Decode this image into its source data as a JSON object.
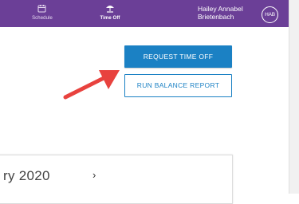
{
  "nav": {
    "items": [
      {
        "label": "Schedule",
        "icon": "calendar-icon",
        "active": false
      },
      {
        "label": "Time Off",
        "icon": "beach-umbrella-icon",
        "active": true
      }
    ]
  },
  "user": {
    "name": "Hailey Annabel Brietenbach",
    "initials": "HAB"
  },
  "actions": {
    "request_time_off": "REQUEST TIME OFF",
    "run_balance_report": "RUN BALANCE REPORT"
  },
  "calendar": {
    "month_label": "ry 2020",
    "next_label": "›"
  },
  "colors": {
    "brand": "#6b3f97",
    "accent": "#1b81c4",
    "arrow": "#e8423e"
  }
}
